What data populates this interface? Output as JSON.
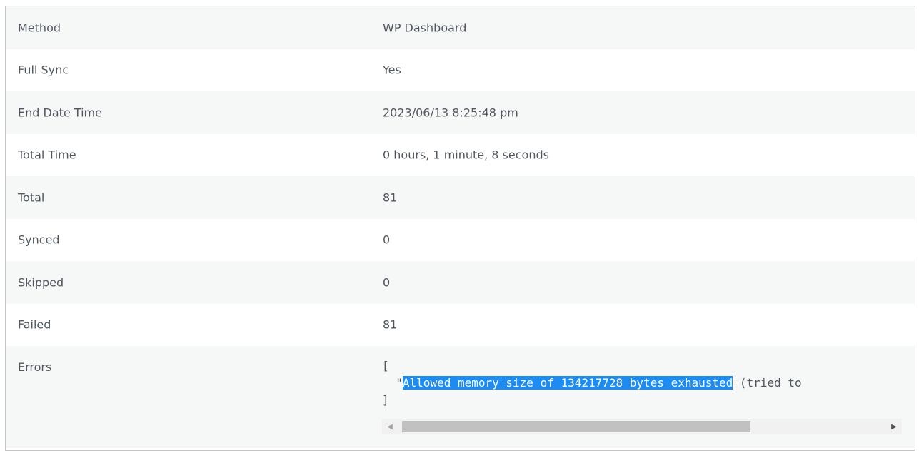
{
  "rows": [
    {
      "label": "Method",
      "value": "WP Dashboard"
    },
    {
      "label": "Full Sync",
      "value": "Yes"
    },
    {
      "label": "End Date Time",
      "value": "2023/06/13 8:25:48 pm"
    },
    {
      "label": "Total Time",
      "value": "0 hours, 1 minute, 8 seconds"
    },
    {
      "label": "Total",
      "value": "81"
    },
    {
      "label": "Synced",
      "value": "0"
    },
    {
      "label": "Skipped",
      "value": "0"
    },
    {
      "label": "Failed",
      "value": "81"
    }
  ],
  "errors": {
    "label": "Errors",
    "open_bracket": "[",
    "indent_quote": "  \"",
    "selected_text": "Allowed memory size of 134217728 bytes exhausted",
    "rest_text": " (tried to",
    "close_bracket": "]"
  },
  "scrollbar": {
    "left_arrow": "◀",
    "right_arrow": "▶"
  },
  "colors": {
    "selection": "#1e8bf0",
    "alt_row": "#f6f7f7",
    "border": "#c3c4c7"
  }
}
